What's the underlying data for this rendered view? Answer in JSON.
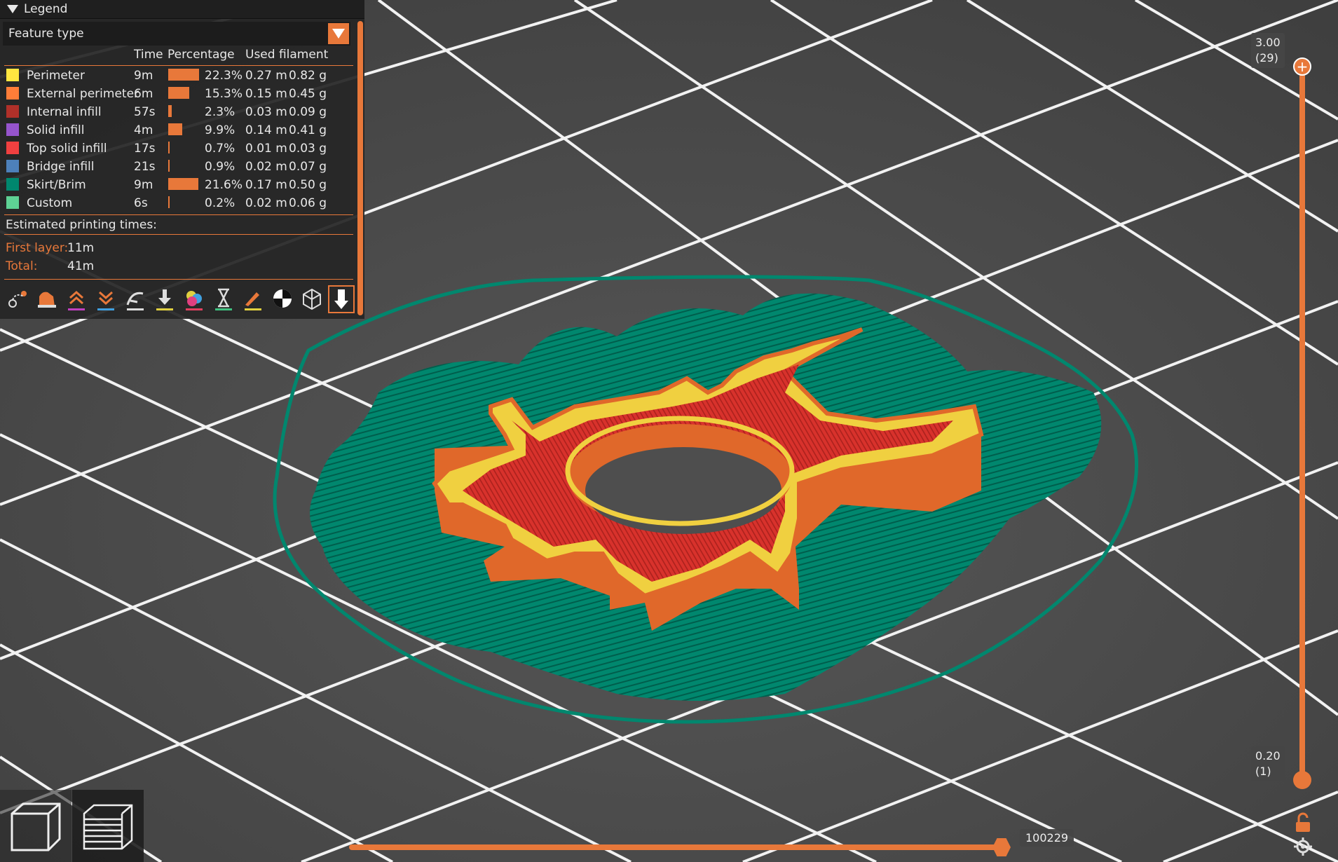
{
  "legend": {
    "title": "Legend",
    "view_type": "Feature type",
    "headers": {
      "time": "Time",
      "percentage": "Percentage",
      "used_filament": "Used filament"
    },
    "rows": [
      {
        "name": "Perimeter",
        "color": "#FFE640",
        "time": "9m",
        "percent": "22.3%",
        "pct_value": 22.3,
        "length": "0.27 m",
        "weight": "0.82 g"
      },
      {
        "name": "External perimeter",
        "color": "#FF7D38",
        "time": "6m",
        "percent": "15.3%",
        "pct_value": 15.3,
        "length": "0.15 m",
        "weight": "0.45 g"
      },
      {
        "name": "Internal infill",
        "color": "#B03029",
        "time": "57s",
        "percent": "2.3%",
        "pct_value": 2.3,
        "length": "0.03 m",
        "weight": "0.09 g"
      },
      {
        "name": "Solid infill",
        "color": "#9654CC",
        "time": "4m",
        "percent": "9.9%",
        "pct_value": 9.9,
        "length": "0.14 m",
        "weight": "0.41 g"
      },
      {
        "name": "Top solid infill",
        "color": "#F04040",
        "time": "17s",
        "percent": "0.7%",
        "pct_value": 0.7,
        "length": "0.01 m",
        "weight": "0.03 g"
      },
      {
        "name": "Bridge infill",
        "color": "#4D80BA",
        "time": "21s",
        "percent": "0.9%",
        "pct_value": 0.9,
        "length": "0.02 m",
        "weight": "0.07 g"
      },
      {
        "name": "Skirt/Brim",
        "color": "#00876E",
        "time": "9m",
        "percent": "21.6%",
        "pct_value": 21.6,
        "length": "0.17 m",
        "weight": "0.50 g"
      },
      {
        "name": "Custom",
        "color": "#5ED194",
        "time": "6s",
        "percent": "0.2%",
        "pct_value": 0.2,
        "length": "0.02 m",
        "weight": "0.06 g"
      }
    ],
    "estimated_label": "Estimated printing times:",
    "first_layer_label": "First layer:",
    "first_layer_value": "11m",
    "total_label": "Total:",
    "total_value": "41m"
  },
  "toolbar_icons": [
    "travel-icon",
    "wipe-icon",
    "retractions-icon",
    "deretractions-icon",
    "seams-icon",
    "tool-changes-icon",
    "color-changes-icon",
    "pause-prints-icon",
    "custom-gcodes-icon",
    "center-of-gravity-icon",
    "shells-icon",
    "tool-marker-icon"
  ],
  "layer_slider": {
    "top_value": "3.00",
    "top_layer": "(29)",
    "bottom_value": "0.20",
    "bottom_layer": "(1)"
  },
  "move_slider": {
    "value": "100229"
  },
  "colors": {
    "accent": "#E8783A",
    "bed": "#4A4A4A",
    "grid": "#FFFFFF"
  }
}
